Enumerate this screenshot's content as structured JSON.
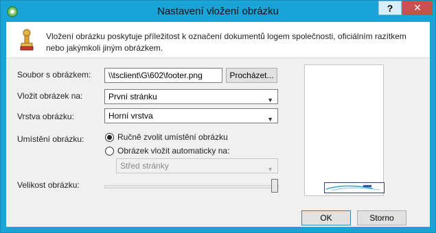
{
  "window": {
    "title": "Nastavení vložení obrázku",
    "help_label": "?",
    "close_label": "✕"
  },
  "intro_text": "Vložení obrázku poskytuje příležitost k označení dokumentů logem společnosti, oficiálním razítkem nebo jakýmkoli jiným obrázkem.",
  "form": {
    "file_label": "Soubor s obrázkem:",
    "file_value": "\\\\tsclient\\G\\602\\footer.png",
    "browse_label": "Procházet...",
    "insert_on_label": "Vložit obrázek na:",
    "insert_on_value": "První stránku",
    "layer_label": "Vrstva obrázku:",
    "layer_value": "Horní vrstva",
    "placement_label": "Umístění obrázku:",
    "manual_option": "Ručně zvolit umístění obrázku",
    "auto_option": "Obrázek vložit automaticky na:",
    "auto_position_value": "Střed stránky",
    "size_label": "Velikost obrázku:",
    "size_level": 1.0
  },
  "buttons": {
    "ok_label": "OK",
    "cancel_label": "Storno"
  },
  "colors": {
    "titlebar": "#1aa3d6",
    "close_button": "#c75050",
    "default_button_border": "#3c7fb1"
  }
}
